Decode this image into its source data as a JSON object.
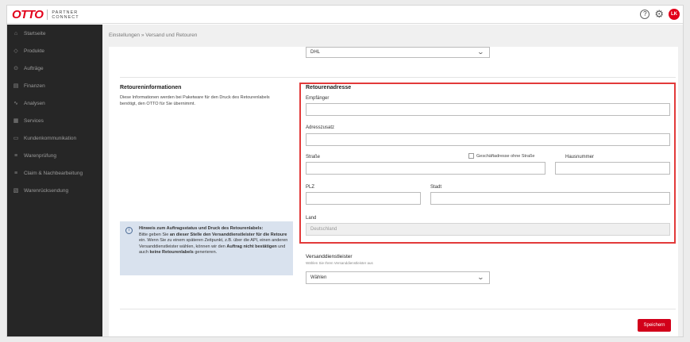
{
  "topbar": {
    "logo_brand": "OTTO",
    "logo_line1": "PARTNER",
    "logo_line2": "CONNECT",
    "help_icon": "?",
    "avatar_initials": "LK"
  },
  "sidebar": {
    "items": [
      {
        "label": "Startseite",
        "icon": "home-icon",
        "glyph": "⌂"
      },
      {
        "label": "Produkte",
        "icon": "tag-icon",
        "glyph": "◇"
      },
      {
        "label": "Aufträge",
        "icon": "orders-icon",
        "glyph": "⊙"
      },
      {
        "label": "Finanzen",
        "icon": "finance-icon",
        "glyph": "▤"
      },
      {
        "label": "Analysen",
        "icon": "analytics-icon",
        "glyph": "∿"
      },
      {
        "label": "Services",
        "icon": "services-icon",
        "glyph": "▦"
      },
      {
        "label": "Kundenkommunikation",
        "icon": "chat-icon",
        "glyph": "▭"
      },
      {
        "label": "Warenprüfung",
        "icon": "checklist-icon",
        "glyph": "≡"
      },
      {
        "label": "Claim & Nachbearbeitung",
        "icon": "claim-icon",
        "glyph": "≡"
      },
      {
        "label": "Warenrücksendung",
        "icon": "return-icon",
        "glyph": "▧"
      }
    ]
  },
  "breadcrumb": "Einstellungen » Versand und Retouren",
  "top_dropdown_value": "DHL",
  "retoureninfo": {
    "title": "Retoureninformationen",
    "description": "Diese Informationen werden bei Paketware für den Druck des Retourenlabels benötigt, den OTTO für Sie übernimmt."
  },
  "address": {
    "title": "Retourenadresse",
    "empfaenger_label": "Empfänger",
    "adresszusatz_label": "Adresszusatz",
    "strasse_label": "Straße",
    "no_street_checkbox": "Geschäftadresse ohne Straße",
    "hausnummer_label": "Hausnummer",
    "plz_label": "PLZ",
    "stadt_label": "Stadt",
    "land_label": "Land",
    "land_value": "Deutschland"
  },
  "hint": {
    "p1": "Hinweis zum Auftragsstatus und Druck des Retourenlabels:",
    "p2": "Bitte geben Sie ",
    "p3": "an dieser Stelle den Versanddienstleister für die Retoure",
    "p4": " ein. Wenn Sie zu einem späteren Zeitpunkt, z.B. über die API, einen anderen Versanddienstleister wählen, können wir den ",
    "p5": "Auftrag nicht bestätigen",
    "p6": " und auch ",
    "p7": "keine Retourenlabels",
    "p8": " generieren."
  },
  "carrier": {
    "label": "Versanddienstleister",
    "sublabel": "Wählen Sie Ihren Versanddienstleister aus",
    "value": "Wählen"
  },
  "save_label": "Speichern",
  "colors": {
    "accent": "#d2001a",
    "highlight_border": "#e23a3a",
    "sidebar_bg": "#262626",
    "hint_bg": "#d9e2ee"
  }
}
